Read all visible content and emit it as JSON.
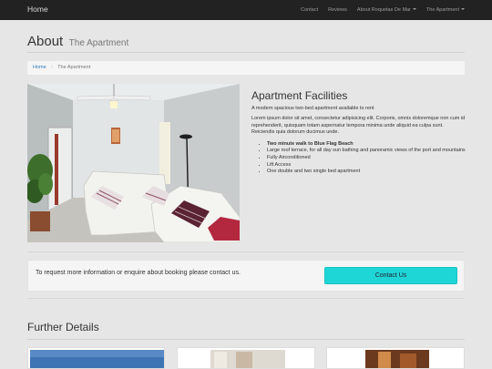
{
  "navbar": {
    "brand": "Home",
    "links": [
      {
        "label": "Contact"
      },
      {
        "label": "Reviews"
      },
      {
        "label": "About Roquetas De Mar"
      },
      {
        "label": "The Apartment"
      }
    ]
  },
  "header": {
    "title": "About",
    "subtitle": "The Apartment"
  },
  "breadcrumb": {
    "home": "Home",
    "current": "The Apartment"
  },
  "facilities": {
    "title": "Apartment Facilities",
    "lead": "A modern spacious two-bed apartment available to rent",
    "text": "Lorem ipsum dolor sit amet, consectetur adipisicing elit. Corporis, omnis doloremque non cum id reprehenderit, quisquam totam aspernatur tempora minima unde aliquid ea culpa sunt. Reiciendis quia dolorum ducimus unde.",
    "items": [
      "Two minute walk to Blue Flag Beach",
      "Large roof terrace, for all day sun bathing and panoramic views of the port and mountains",
      "Fully Airconditioned",
      "Lift Access",
      "One double and two single bed apartment"
    ]
  },
  "contact": {
    "text": "To request more information or enquire about booking please contact us.",
    "button": "Contact Us"
  },
  "further": {
    "title": "Further Details"
  },
  "icons": [
    "dropdown-caret-icon"
  ],
  "colors": {
    "navbar": "#222222",
    "button": "#1fd6d6",
    "link": "#337ab7"
  }
}
